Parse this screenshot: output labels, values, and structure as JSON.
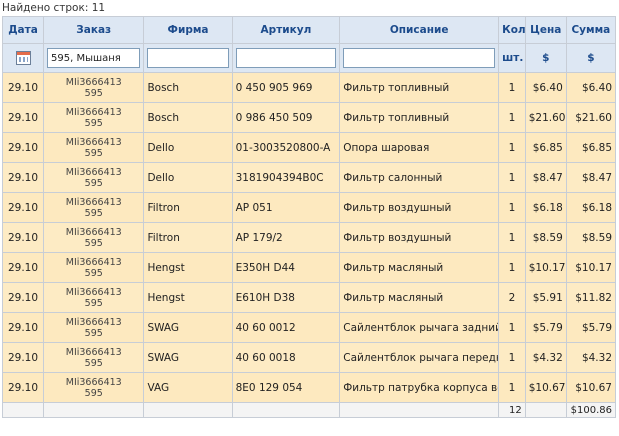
{
  "found_text": "Найдено строк: 11",
  "headers": {
    "date": "Дата",
    "order": "Заказ",
    "firm": "Фирма",
    "article": "Артикул",
    "description": "Описание",
    "qty": "Кол",
    "price": "Цена",
    "sum": "Сумма",
    "qty_unit": "шт.",
    "price_unit": "$",
    "sum_unit": "$"
  },
  "filters": {
    "order_value": "595, Мышаня",
    "firm_value": "",
    "article_value": "",
    "description_value": ""
  },
  "rows": [
    {
      "date": "29.10",
      "order_line1": "MIi3666413",
      "order_line2": "595",
      "firm": "Bosch",
      "article": "0 450 905 969",
      "description": "Фильтр топливный",
      "qty": "1",
      "price": "$6.40",
      "sum": "$6.40"
    },
    {
      "date": "29.10",
      "order_line1": "MIi3666413",
      "order_line2": "595",
      "firm": "Bosch",
      "article": "0 986 450 509",
      "description": "Фильтр топливный",
      "qty": "1",
      "price": "$21.60",
      "sum": "$21.60"
    },
    {
      "date": "29.10",
      "order_line1": "MIi3666413",
      "order_line2": "595",
      "firm": "Dello",
      "article": "01-3003520800-A",
      "description": "Опора шаровая",
      "qty": "1",
      "price": "$6.85",
      "sum": "$6.85"
    },
    {
      "date": "29.10",
      "order_line1": "MIi3666413",
      "order_line2": "595",
      "firm": "Dello",
      "article": "3181904394B0C",
      "description": "Фильтр салонный",
      "qty": "1",
      "price": "$8.47",
      "sum": "$8.47"
    },
    {
      "date": "29.10",
      "order_line1": "MIi3666413",
      "order_line2": "595",
      "firm": "Filtron",
      "article": "AP 051",
      "description": "Фильтр воздушный",
      "qty": "1",
      "price": "$6.18",
      "sum": "$6.18"
    },
    {
      "date": "29.10",
      "order_line1": "MIi3666413",
      "order_line2": "595",
      "firm": "Filtron",
      "article": "AP 179/2",
      "description": "Фильтр воздушный",
      "qty": "1",
      "price": "$8.59",
      "sum": "$8.59"
    },
    {
      "date": "29.10",
      "order_line1": "MIi3666413",
      "order_line2": "595",
      "firm": "Hengst",
      "article": "E350H D44",
      "description": "Фильтр масляный",
      "qty": "1",
      "price": "$10.17",
      "sum": "$10.17"
    },
    {
      "date": "29.10",
      "order_line1": "MIi3666413",
      "order_line2": "595",
      "firm": "Hengst",
      "article": "E610H D38",
      "description": "Фильтр масляный",
      "qty": "2",
      "price": "$5.91",
      "sum": "$11.82"
    },
    {
      "date": "29.10",
      "order_line1": "MIi3666413",
      "order_line2": "595",
      "firm": "SWAG",
      "article": "40 60 0012",
      "description": "Сайлентблок рычага задний",
      "qty": "1",
      "price": "$5.79",
      "sum": "$5.79"
    },
    {
      "date": "29.10",
      "order_line1": "MIi3666413",
      "order_line2": "595",
      "firm": "SWAG",
      "article": "40 60 0018",
      "description": "Сайлентблок рычага передний",
      "qty": "1",
      "price": "$4.32",
      "sum": "$4.32"
    },
    {
      "date": "29.10",
      "order_line1": "MIi3666413",
      "order_line2": "595",
      "firm": "VAG",
      "article": "8E0 129 054",
      "description": "Фильтр патрубка корпуса воздушного фильтра",
      "qty": "1",
      "price": "$10.67",
      "sum": "$10.67"
    }
  ],
  "totals": {
    "qty": "12",
    "sum": "$100.86"
  }
}
